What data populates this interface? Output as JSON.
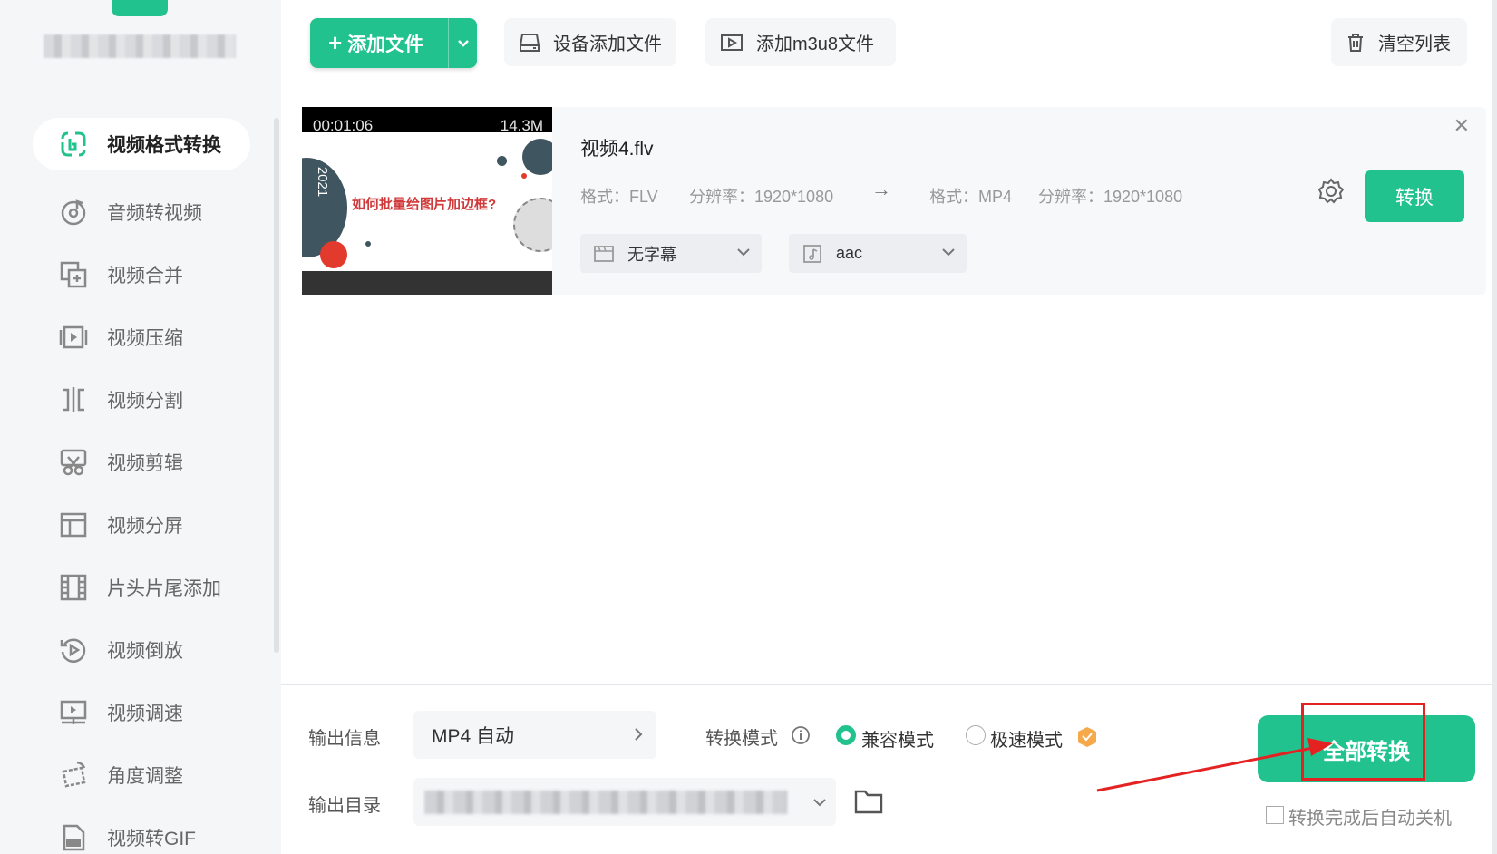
{
  "sidebar": {
    "items": [
      {
        "label": "视频格式转换",
        "icon": "format-convert-icon"
      },
      {
        "label": "音频转视频",
        "icon": "audio-to-video-icon"
      },
      {
        "label": "视频合并",
        "icon": "merge-icon"
      },
      {
        "label": "视频压缩",
        "icon": "compress-icon"
      },
      {
        "label": "视频分割",
        "icon": "split-icon"
      },
      {
        "label": "视频剪辑",
        "icon": "scissors-icon"
      },
      {
        "label": "视频分屏",
        "icon": "split-screen-icon"
      },
      {
        "label": "片头片尾添加",
        "icon": "film-icon"
      },
      {
        "label": "视频倒放",
        "icon": "reverse-icon"
      },
      {
        "label": "视频调速",
        "icon": "speed-icon"
      },
      {
        "label": "角度调整",
        "icon": "rotate-icon"
      },
      {
        "label": "视频转GIF",
        "icon": "gif-icon"
      }
    ]
  },
  "toolbar": {
    "add_file": "添加文件",
    "device_add": "设备添加文件",
    "add_m3u8": "添加m3u8文件",
    "clear_list": "清空列表"
  },
  "file": {
    "thumb_duration": "00:01:06",
    "thumb_size": "14.3M",
    "thumb_year": "2021",
    "thumb_title": "如何批量给图片加边框?",
    "name": "视频4.flv",
    "src_format": "格式：FLV",
    "src_resolution": "分辨率：1920*1080",
    "dst_format": "格式：MP4",
    "dst_resolution": "分辨率：1920*1080",
    "subtitle": "无字幕",
    "audio": "aac",
    "convert": "转换"
  },
  "bottom": {
    "output_info_label": "输出信息",
    "output_info_value": "MP4 自动",
    "output_dir_label": "输出目录",
    "mode_label": "转换模式",
    "mode_compatible": "兼容模式",
    "mode_fast": "极速模式",
    "convert_all": "全部转换",
    "auto_shutdown": "转换完成后自动关机"
  },
  "colors": {
    "accent": "#22c28f",
    "annotation": "#e52222"
  }
}
